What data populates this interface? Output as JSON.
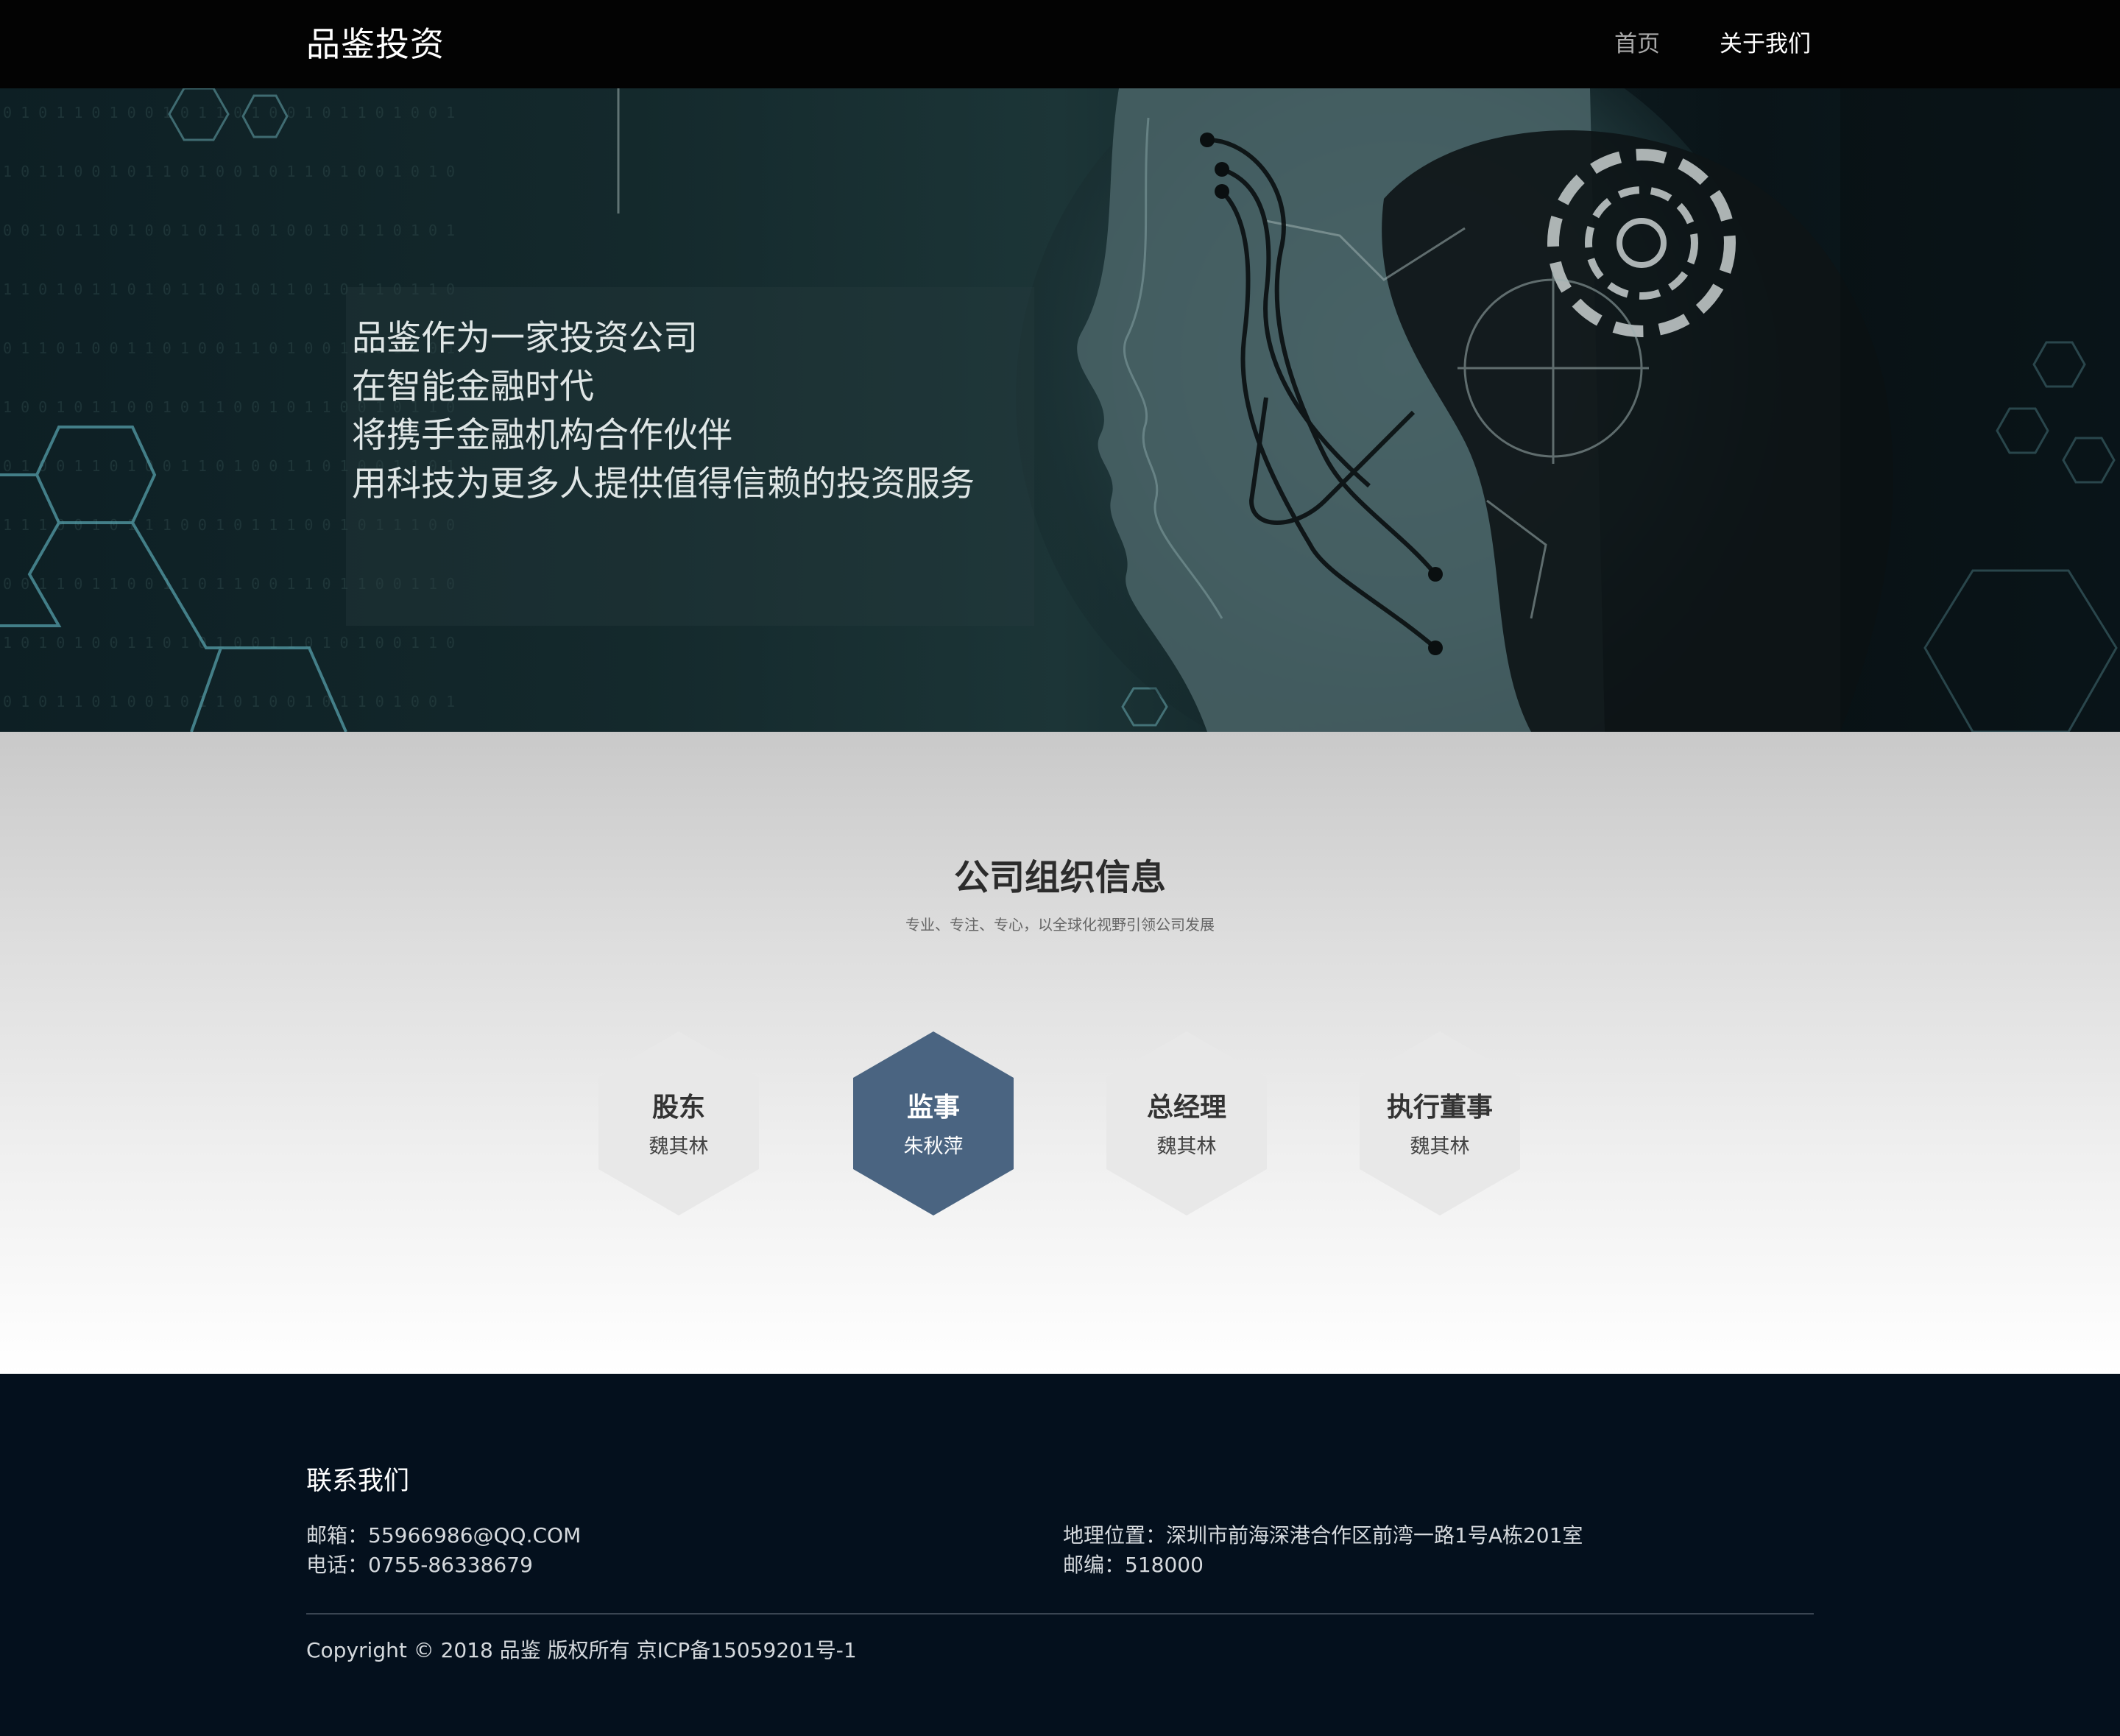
{
  "nav": {
    "brand": "品鉴投资",
    "links": [
      {
        "label": "首页",
        "active": false
      },
      {
        "label": "关于我们",
        "active": true
      }
    ]
  },
  "hero": {
    "lines": [
      "品鉴作为一家投资公司",
      "在智能金融时代",
      "将携手金融机构合作伙伴",
      "用科技为更多人提供值得信赖的投资服务"
    ]
  },
  "org": {
    "title": "公司组织信息",
    "subtitle": "专业、专注、专心，以全球化视野引领公司发展",
    "members": [
      {
        "role": "股东",
        "name": "魏其林",
        "highlighted": false
      },
      {
        "role": "监事",
        "name": "朱秋萍",
        "highlighted": true
      },
      {
        "role": "总经理",
        "name": "魏其林",
        "highlighted": false
      },
      {
        "role": "执行董事",
        "name": "魏其林",
        "highlighted": false
      }
    ]
  },
  "footer": {
    "title": "联系我们",
    "email": "邮箱：55966986@QQ.COM",
    "phone": "电话：0755-86338679",
    "address": "地理位置：深圳市前海深港合作区前湾一路1号A栋201室",
    "postcode": "邮编：518000",
    "copyright": "Copyright © 2018 品鉴 版权所有 京ICP备15059201号-1"
  },
  "colors": {
    "nav_bg": "#030303",
    "highlight_hex": "#4a6481",
    "neutral_hex": "#e8e8e8",
    "footer_bg": "#04101d"
  }
}
